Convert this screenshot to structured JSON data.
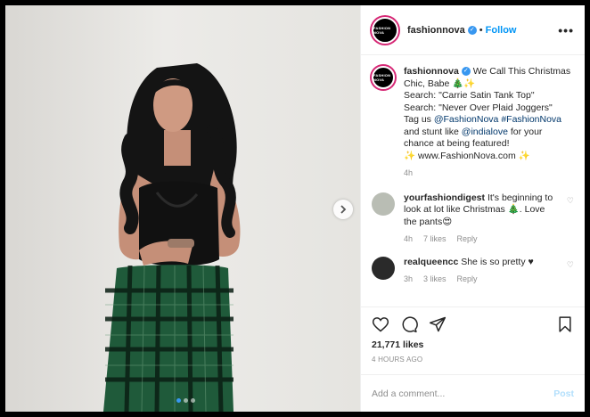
{
  "header": {
    "username": "fashionnova",
    "avatar_text": "FASHION NOVA",
    "follow_label": "Follow",
    "separator": "•",
    "more_label": "•••"
  },
  "caption": {
    "username": "fashionnova",
    "line1": "We Call This Christmas Chic, Babe 🎄✨",
    "line2": "Search: \"Carrie Satin Tank Top\"",
    "line3": "Search: \"Never Over Plaid Joggers\"",
    "tag_prefix": "Tag us",
    "mention1": "@FashionNova",
    "hashtag": "#FashionNova",
    "stunt_prefix": "and stunt like",
    "mention2": "@indialove",
    "tail": "for your chance at being featured!",
    "website": "✨ www.FashionNova.com ✨",
    "time": "4h"
  },
  "comments": [
    {
      "username": "yourfashiondigest",
      "text": "It's beginning to look at lot like Christmas 🎄. Love the pants😍",
      "time": "4h",
      "likes": "7 likes",
      "reply": "Reply",
      "avatar_color": "#b9bdb4"
    },
    {
      "username": "realqueencc",
      "text": "She is so pretty ♥",
      "time": "3h",
      "likes": "3 likes",
      "reply": "Reply",
      "avatar_color": "#2a2a2a"
    }
  ],
  "actions": {
    "likes_count": "21,771 likes",
    "posted_ago": "4 HOURS AGO"
  },
  "add_comment": {
    "placeholder": "Add a comment...",
    "post_label": "Post"
  },
  "colors": {
    "accent": "#0095f6",
    "verified": "#3897f0",
    "plaid_green": "#1f5a3a"
  }
}
